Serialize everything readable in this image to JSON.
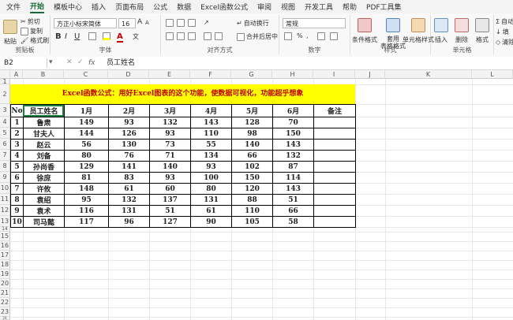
{
  "menu": {
    "items": [
      "文件",
      "开始",
      "模板中心",
      "插入",
      "页面布局",
      "公式",
      "数据",
      "Excel函数公式",
      "审阅",
      "视图",
      "开发工具",
      "帮助",
      "PDF工具集"
    ],
    "active_index": 1
  },
  "ribbon": {
    "clipboard": {
      "paste": "粘贴",
      "cut": "剪切",
      "copy": "复制",
      "format_painter": "格式刷",
      "label": "剪贴板"
    },
    "font": {
      "name": "方正小标宋简体",
      "size": "16",
      "bold": "B",
      "italic": "I",
      "underline": "U",
      "grow": "A",
      "shrink": "A",
      "color_a": "A",
      "wen": "文",
      "label": "字体"
    },
    "alignment": {
      "wrap": "自动换行",
      "merge": "合并后居中",
      "label": "对齐方式"
    },
    "number": {
      "format": "常规",
      "percent": "%",
      "comma": ",",
      "label": "数字"
    },
    "styles": {
      "conditional": "条件格式",
      "table": "套用\n表格格式",
      "cell": "单元格样式",
      "label": "样式"
    },
    "cells": {
      "insert": "插入",
      "delete": "删除",
      "format": "格式",
      "label": "单元格"
    },
    "editing": {
      "autosum": "自动",
      "fill": "填",
      "clear": "清除"
    }
  },
  "formula_bar": {
    "name_box": "B2",
    "fx": "fx",
    "content": "员工姓名"
  },
  "columns": [
    "A",
    "B",
    "C",
    "D",
    "E",
    "F",
    "G",
    "H",
    "I",
    "J",
    "K",
    "L"
  ],
  "rows": [
    "1",
    "2",
    "3",
    "4",
    "5",
    "6",
    "7",
    "8",
    "9",
    "10",
    "11",
    "12",
    "13",
    "14",
    "15",
    "16",
    "17",
    "18",
    "19",
    "20",
    "21",
    "22",
    "23",
    "24",
    "25",
    "26",
    "27"
  ],
  "sheet": {
    "banner": "Excel函数公式：用好Excel图表的这个功能，使数据可视化，功能超乎想象",
    "headers": [
      "No",
      "员工姓名",
      "1月",
      "2月",
      "3月",
      "4月",
      "5月",
      "6月",
      "备注"
    ],
    "records": [
      [
        "1",
        "鲁肃",
        "149",
        "93",
        "132",
        "143",
        "128",
        "70",
        ""
      ],
      [
        "2",
        "甘夫人",
        "144",
        "126",
        "93",
        "110",
        "98",
        "150",
        ""
      ],
      [
        "3",
        "赵云",
        "56",
        "130",
        "73",
        "55",
        "140",
        "143",
        ""
      ],
      [
        "4",
        "刘备",
        "80",
        "76",
        "71",
        "134",
        "66",
        "132",
        ""
      ],
      [
        "5",
        "孙尚香",
        "129",
        "141",
        "140",
        "93",
        "102",
        "87",
        ""
      ],
      [
        "6",
        "徐庶",
        "81",
        "83",
        "93",
        "100",
        "150",
        "114",
        ""
      ],
      [
        "7",
        "许攸",
        "148",
        "61",
        "60",
        "80",
        "120",
        "143",
        ""
      ],
      [
        "8",
        "袁绍",
        "95",
        "132",
        "137",
        "131",
        "88",
        "51",
        ""
      ],
      [
        "9",
        "袁术",
        "116",
        "131",
        "51",
        "61",
        "110",
        "66",
        ""
      ],
      [
        "10",
        "司马懿",
        "117",
        "96",
        "127",
        "90",
        "105",
        "58",
        ""
      ]
    ]
  }
}
